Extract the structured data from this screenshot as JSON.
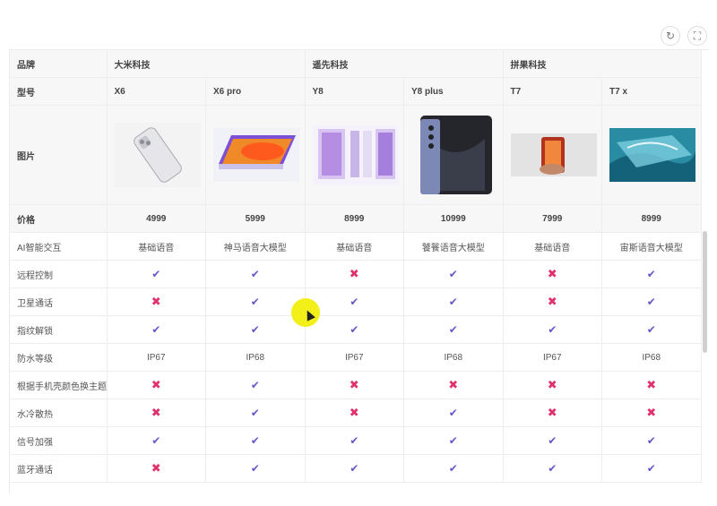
{
  "toolbar": {
    "refresh_icon": "refresh-icon",
    "fullscreen_icon": "fullscreen-icon"
  },
  "table": {
    "row_labels": {
      "brand": "品牌",
      "model": "型号",
      "picture": "图片",
      "price": "价格"
    },
    "brands": [
      {
        "name": "大米科技"
      },
      {
        "name": "遥先科技"
      },
      {
        "name": "拼果科技"
      }
    ],
    "models": [
      "X6",
      "X6 pro",
      "Y8",
      "Y8 plus",
      "T7",
      "T7 x"
    ],
    "prices": [
      "4999",
      "5999",
      "8999",
      "10999",
      "7999",
      "8999"
    ],
    "features": [
      {
        "label": "AI智能交互",
        "values": [
          "基础语音",
          "神马语音大模型",
          "基础语音",
          "饕餮语音大模型",
          "基础语音",
          "宙斯语音大模型"
        ]
      },
      {
        "label": "远程控制",
        "values": [
          "✔",
          "✔",
          "✖",
          "✔",
          "✖",
          "✔"
        ]
      },
      {
        "label": "卫星通话",
        "values": [
          "✖",
          "✔",
          "✔",
          "✔",
          "✖",
          "✔"
        ]
      },
      {
        "label": "指纹解锁",
        "values": [
          "✔",
          "✔",
          "✔",
          "✔",
          "✔",
          "✔"
        ]
      },
      {
        "label": "防水等级",
        "values": [
          "IP67",
          "IP68",
          "IP67",
          "IP68",
          "IP67",
          "IP68"
        ]
      },
      {
        "label": "根据手机壳颜色换主题",
        "values": [
          "✖",
          "✔",
          "✖",
          "✖",
          "✖",
          "✖"
        ]
      },
      {
        "label": "水冷散热",
        "values": [
          "✖",
          "✔",
          "✖",
          "✔",
          "✖",
          "✖"
        ]
      },
      {
        "label": "信号加强",
        "values": [
          "✔",
          "✔",
          "✔",
          "✔",
          "✔",
          "✔"
        ]
      },
      {
        "label": "蓝牙通话",
        "values": [
          "✖",
          "✔",
          "✔",
          "✔",
          "✔",
          "✔"
        ]
      }
    ]
  },
  "colors": {
    "check": "#6a55c8",
    "cross": "#e0316c",
    "cursor_highlight": "#f3ef19"
  }
}
